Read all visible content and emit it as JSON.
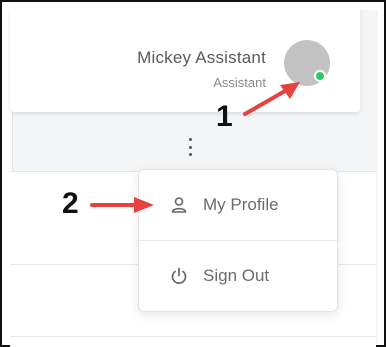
{
  "header": {
    "user_name": "Mickey Assistant",
    "user_role": "Assistant",
    "status_color": "#2ec866"
  },
  "menu": {
    "items": [
      {
        "label": "My Profile",
        "icon": "user-icon"
      },
      {
        "label": "Sign Out",
        "icon": "power-icon"
      }
    ]
  },
  "annotations": {
    "step_1": "1",
    "step_2": "2",
    "arrow_color": "#e8423f"
  }
}
